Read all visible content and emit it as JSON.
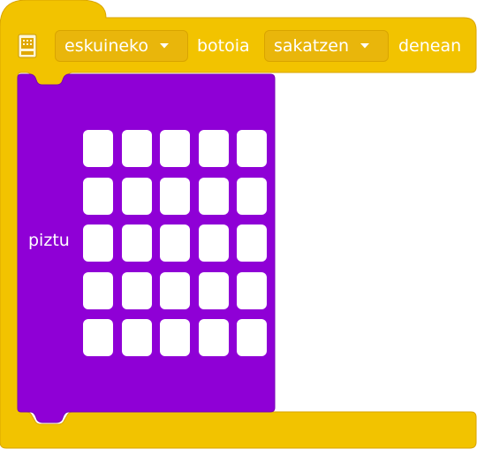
{
  "event_block": {
    "button_dropdown": {
      "selected": "eskuineko"
    },
    "label_button": "botoia",
    "action_dropdown": {
      "selected": "sakatzen"
    },
    "label_when": "denean"
  },
  "led_block": {
    "label": "piztu",
    "grid": {
      "rows": 5,
      "cols": 5,
      "cells": [
        [
          false,
          false,
          false,
          false,
          false
        ],
        [
          false,
          false,
          false,
          false,
          false
        ],
        [
          false,
          false,
          false,
          false,
          false
        ],
        [
          false,
          false,
          false,
          false,
          false
        ],
        [
          false,
          false,
          false,
          false,
          false
        ]
      ]
    }
  },
  "colors": {
    "event_block": "#f2c300",
    "event_block_border": "#d9a400",
    "led_block": "#8f00d6",
    "led_block_border": "#7600b5",
    "led_off": "#ffffff"
  },
  "icons": {
    "event_icon": "microbit-icon",
    "dropdown_caret": "caret-down-icon"
  }
}
